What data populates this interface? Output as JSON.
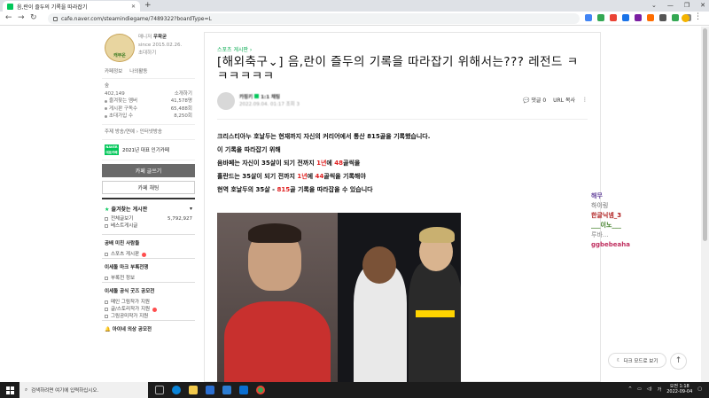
{
  "browser": {
    "tab_title": "음,란이 즐두의 기록을 따라잡기",
    "url": "cafe.naver.com/steamindiegame/7489322?boardType=L",
    "colors": {
      "accent": "#03c75a",
      "tabbar": "#dee1e6"
    }
  },
  "sidebar": {
    "cafe_logo_text": "캐부온",
    "manager_label": "매니저",
    "manager_name": "우왁굳",
    "since": "since 2015.02.26.",
    "invite": "초대하기",
    "links": [
      "카페정보",
      "나의활동"
    ],
    "my_name": "숲",
    "my_points": "402,149",
    "my_points_label": "소개하기",
    "stats": [
      {
        "label": "즐겨찾는 멤버",
        "value": "41,578명"
      },
      {
        "label": "게시판 구독수",
        "value": "65,488회"
      },
      {
        "label": "초대가입 수",
        "value": "8,250회"
      }
    ],
    "topic": "주제 방송/연예 › 인터넷방송",
    "badge_text": "NAVER 대표카페",
    "badge_label": "2021년 대표 인기카페",
    "write_button": "카페 글쓰기",
    "chat_button": "카페 채팅",
    "fav_header": "즐겨찾는 게시판",
    "fav_items": [
      {
        "label": "전체글보기",
        "value": "5,792,927"
      },
      {
        "label": "베스트게시글",
        "value": ""
      }
    ],
    "section1": "공배 미친 사람들",
    "section1_items": [
      "스포츠 게시판"
    ],
    "section2": "이세돌 마크 부록전쟁",
    "section2_items": [
      "부록전 정보"
    ],
    "section3": "이세돌 공식 굿즈 공모전",
    "section3_items": [
      "메인 그림작가 지원",
      "글/스토리작가 지원",
      "그림공미작가 지원"
    ],
    "section4": "아이네 의상 공모전"
  },
  "article": {
    "board": "스포츠 게시판 ›",
    "title": "[해외축구⌄] 음,란이 즐두의 기록을 따라잡기 위해서는??? 레전드 ㅋㅋㅋㅋㅋㅋ",
    "writer_name": "카핑키",
    "writer_level": "1:1 채팅",
    "writer_date": "2022.09.04. 01:17  조회 3",
    "comments": "댓글 0",
    "url_copy": "URL 복사",
    "lines": [
      [
        {
          "t": "크리스티아누 호날두는 현재까지 자신의 커리어에서 통산 815골을 기록했습니다.",
          "c": ""
        }
      ],
      [
        {
          "t": "이 기록을 따라잡기 위해",
          "c": ""
        }
      ],
      [
        {
          "t": "음바페는 자신이 35살이 되기 전까지 ",
          "c": ""
        },
        {
          "t": "1년",
          "c": "red"
        },
        {
          "t": "에 ",
          "c": ""
        },
        {
          "t": "48",
          "c": "red"
        },
        {
          "t": "골씩을",
          "c": ""
        }
      ],
      [
        {
          "t": "홀란드는 35살이 되기 전까지 ",
          "c": ""
        },
        {
          "t": "1년",
          "c": "red"
        },
        {
          "t": "에 ",
          "c": ""
        },
        {
          "t": "44",
          "c": "red"
        },
        {
          "t": "골씩을 기록해야",
          "c": ""
        }
      ],
      [
        {
          "t": "현역 호날두의 35살 - ",
          "c": ""
        },
        {
          "t": "815",
          "c": "red"
        },
        {
          "t": "골 기록을 따라잡을 수 있습니다",
          "c": ""
        }
      ]
    ]
  },
  "chat": [
    {
      "user": "해무",
      "cls": "u1"
    },
    {
      "user": "하이링",
      "cls": "m1"
    },
    {
      "user": "한글닉넴_3",
      "cls": "u2"
    },
    {
      "user": "___이노___",
      "cls": "u3"
    },
    {
      "user": "루바...",
      "cls": "m3"
    },
    {
      "user": "ggbebeaha",
      "cls": "u4"
    }
  ],
  "dark_mode": "다크 모드로 보기",
  "taskbar": {
    "search_placeholder": "검색하려면 여기에 입력하십시오.",
    "time": "오전 1:18",
    "date": "2022-09-04",
    "lang": "가"
  }
}
